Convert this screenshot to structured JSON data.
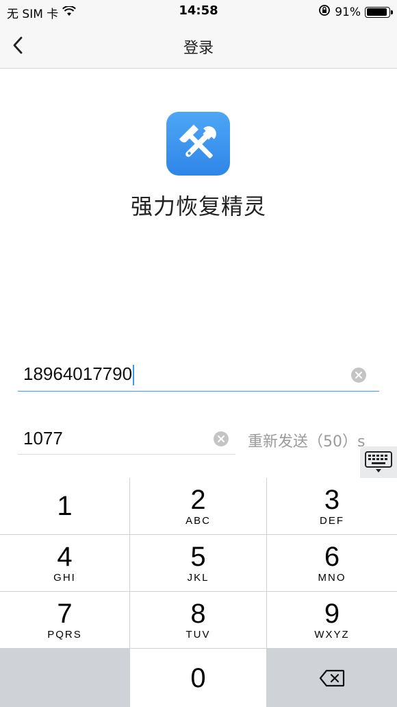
{
  "status_bar": {
    "carrier": "无 SIM 卡",
    "time": "14:58",
    "battery": "91%",
    "battery_level": 0.91
  },
  "nav": {
    "title": "登录"
  },
  "app": {
    "name": "强力恢复精灵"
  },
  "form": {
    "phone_value": "18964017790",
    "code_value": "1077",
    "resend_label": "重新发送（50）s"
  },
  "keypad": {
    "keys": [
      {
        "digit": "1",
        "letters": ""
      },
      {
        "digit": "2",
        "letters": "ABC"
      },
      {
        "digit": "3",
        "letters": "DEF"
      },
      {
        "digit": "4",
        "letters": "GHI"
      },
      {
        "digit": "5",
        "letters": "JKL"
      },
      {
        "digit": "6",
        "letters": "MNO"
      },
      {
        "digit": "7",
        "letters": "PQRS"
      },
      {
        "digit": "8",
        "letters": "TUV"
      },
      {
        "digit": "9",
        "letters": "WXYZ"
      },
      {
        "digit": "0",
        "letters": ""
      }
    ]
  },
  "colors": {
    "accent": "#3b9af0",
    "logo": "#3a91ee"
  }
}
